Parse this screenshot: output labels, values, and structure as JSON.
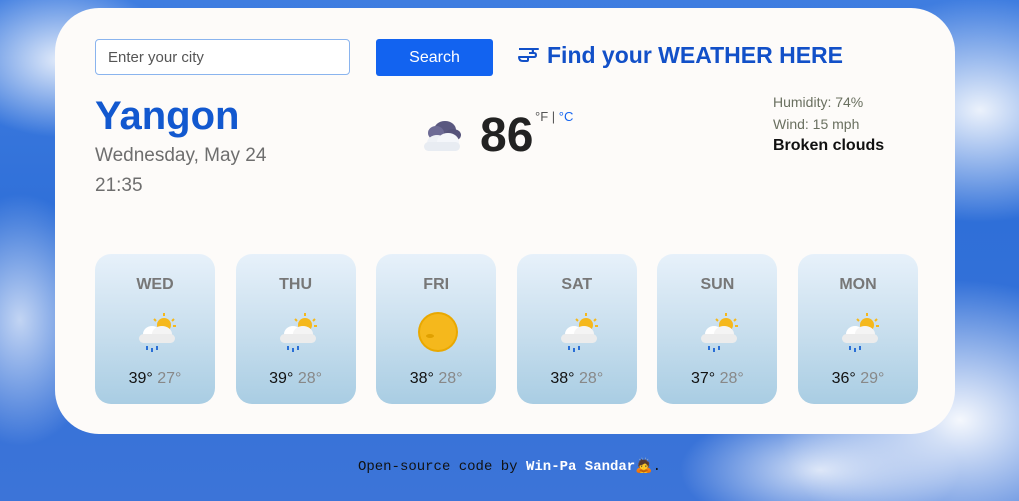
{
  "search": {
    "placeholder": "Enter your city",
    "button_label": "Search"
  },
  "header": {
    "title": "Find your WEATHER HERE",
    "pointer_icon": "pointing-hand-icon"
  },
  "current": {
    "city": "Yangon",
    "date": "Wednesday, May 24",
    "time": "21:35",
    "temperature": "86",
    "unit_f": "°F",
    "unit_separator": "|",
    "unit_c": "°C",
    "humidity": "Humidity: 74%",
    "wind": "Wind: 15 mph",
    "description": "Broken clouds",
    "icon": "broken-clouds-icon"
  },
  "forecast": [
    {
      "day": "WED",
      "high": "39°",
      "low": "27°",
      "icon": "sun-rain-cloud-icon"
    },
    {
      "day": "THU",
      "high": "39°",
      "low": "28°",
      "icon": "sun-rain-cloud-icon"
    },
    {
      "day": "FRI",
      "high": "38°",
      "low": "28°",
      "icon": "sun-icon"
    },
    {
      "day": "SAT",
      "high": "38°",
      "low": "28°",
      "icon": "sun-rain-cloud-icon"
    },
    {
      "day": "SUN",
      "high": "37°",
      "low": "28°",
      "icon": "sun-rain-cloud-icon"
    },
    {
      "day": "MON",
      "high": "36°",
      "low": "29°",
      "icon": "sun-rain-cloud-icon"
    }
  ],
  "footer": {
    "link_text": "Open-source code",
    "by": "by",
    "author": "Win-Pa Sandar",
    "emoji": "🙇",
    "end": "."
  },
  "colors": {
    "accent": "#1263f0",
    "city": "#1258cf",
    "card": "#fdfbf9"
  }
}
